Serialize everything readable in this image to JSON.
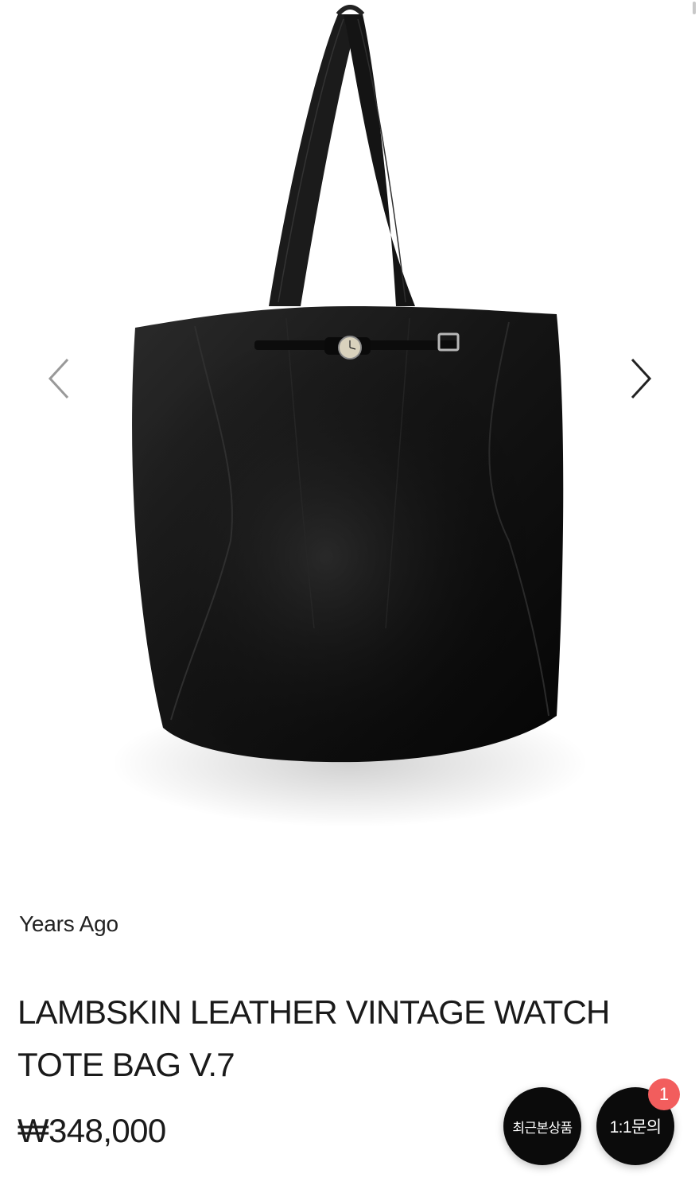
{
  "gallery": {
    "image_alt": "Black lambskin leather tote bag with vintage watch strap",
    "prev_icon": "chevron-left-icon",
    "next_icon": "chevron-right-icon"
  },
  "product": {
    "brand": "Years Ago",
    "title": "LAMBSKIN LEATHER VINTAGE WATCH TOTE BAG V.7",
    "price": "₩348,000"
  },
  "floating_buttons": {
    "recent_label": "최근본상품",
    "inquiry_label": "1:1문의",
    "inquiry_badge": "1"
  },
  "colors": {
    "background": "#ffffff",
    "button_bg": "#0b0b0b",
    "badge_bg": "#f25d5d"
  }
}
